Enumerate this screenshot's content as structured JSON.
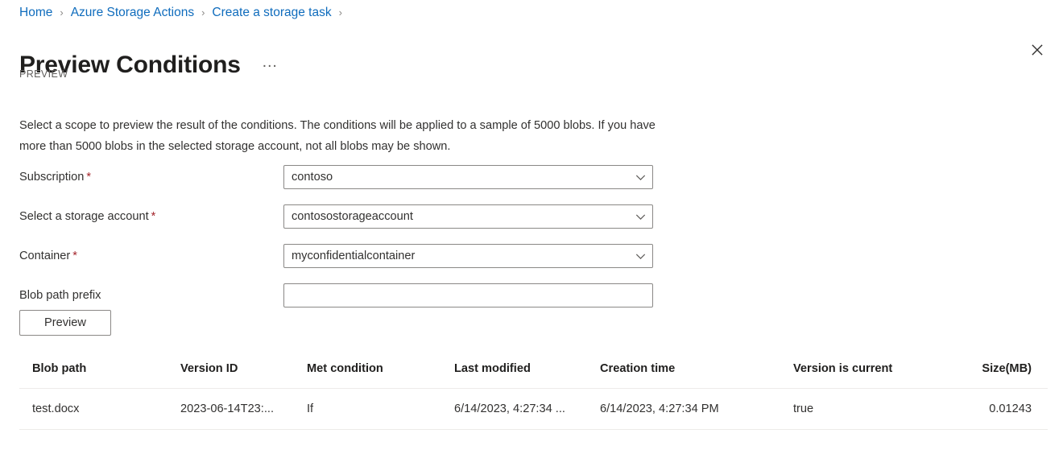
{
  "breadcrumb": {
    "separator": "›",
    "items": [
      {
        "label": "Home"
      },
      {
        "label": "Azure Storage Actions"
      },
      {
        "label": "Create a storage task"
      }
    ]
  },
  "header": {
    "title": "Preview Conditions",
    "ellipsis": "…",
    "preview_tag": "PREVIEW",
    "close_icon": "close-icon"
  },
  "description": "Select a scope to preview the result of the conditions. The conditions will be applied to a sample of 5000 blobs. If you have more than 5000 blobs in the selected storage account, not all blobs may be shown.",
  "form": {
    "required_marker": "*",
    "fields": [
      {
        "label": "Subscription",
        "required": true,
        "type": "dropdown",
        "value": "contoso",
        "placeholder": "",
        "icon": "chevron-down-icon"
      },
      {
        "label": "Select a storage account",
        "required": true,
        "type": "dropdown",
        "value": "contosostorageaccount",
        "placeholder": "",
        "icon": "chevron-down-icon"
      },
      {
        "label": "Container",
        "required": true,
        "type": "dropdown",
        "value": "myconfidentialcontainer",
        "placeholder": "",
        "icon": "chevron-down-icon"
      },
      {
        "label": "Blob path prefix",
        "required": false,
        "type": "text",
        "value": "",
        "placeholder": "",
        "icon": ""
      }
    ],
    "preview_button": "Preview"
  },
  "table": {
    "columns": [
      "Blob path",
      "Version ID",
      "Met condition",
      "Last modified",
      "Creation time",
      "Version is current",
      "Size(MB)"
    ],
    "rows": [
      {
        "blob_path": "test.docx",
        "version_id": "2023-06-14T23:...",
        "met_condition": "If",
        "last_modified": "6/14/2023, 4:27:34 ...",
        "creation_time": "6/14/2023, 4:27:34 PM",
        "version_is_current": "true",
        "size_mb": "0.01243"
      }
    ]
  },
  "colors": {
    "link": "#0f6cbd",
    "required": "#a4262c",
    "text": "#323130",
    "muted": "#605e5c",
    "border": "#8a8886",
    "divider": "#edebe9"
  }
}
